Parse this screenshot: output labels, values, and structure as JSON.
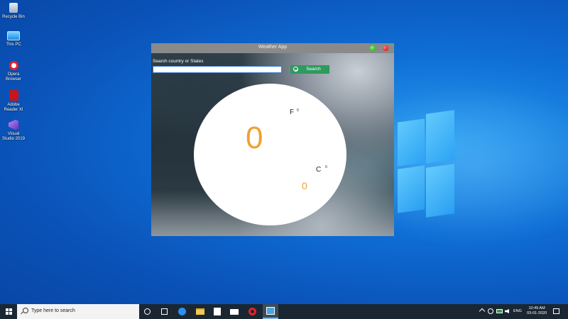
{
  "desktop": {
    "icons": [
      {
        "label": "Recycle Bin",
        "icon": "recycle-bin-icon"
      },
      {
        "label": "This PC",
        "icon": "computer-icon"
      },
      {
        "label": "Opera Browser",
        "icon": "opera-icon"
      },
      {
        "label": "Adobe Reader XI",
        "icon": "pdf-icon"
      },
      {
        "label": "Visual Studio 2019",
        "icon": "visual-studio-icon"
      }
    ]
  },
  "window": {
    "title": "Weather App",
    "search": {
      "label": "Search country or States",
      "value": "",
      "placeholder": "",
      "button_label": "Search"
    },
    "weather": {
      "main_value": "0",
      "unit_f": "F",
      "deg_f": "0",
      "unit_c": "C",
      "deg_c": "0",
      "secondary_value": "0"
    },
    "colors": {
      "accent_orange": "#f0a030",
      "button_green": "#2e9a5e",
      "titlebar": "#8a8a8a"
    }
  },
  "taskbar": {
    "search_placeholder": "Type here to search",
    "language": "ENG",
    "time": "10:49 AM",
    "date": "03-01-2020",
    "apps": [
      "task-view-icon",
      "action-center-icon",
      "edge-icon",
      "file-explorer-icon",
      "store-icon",
      "mail-icon",
      "opera-icon",
      "weather-app-icon"
    ]
  }
}
